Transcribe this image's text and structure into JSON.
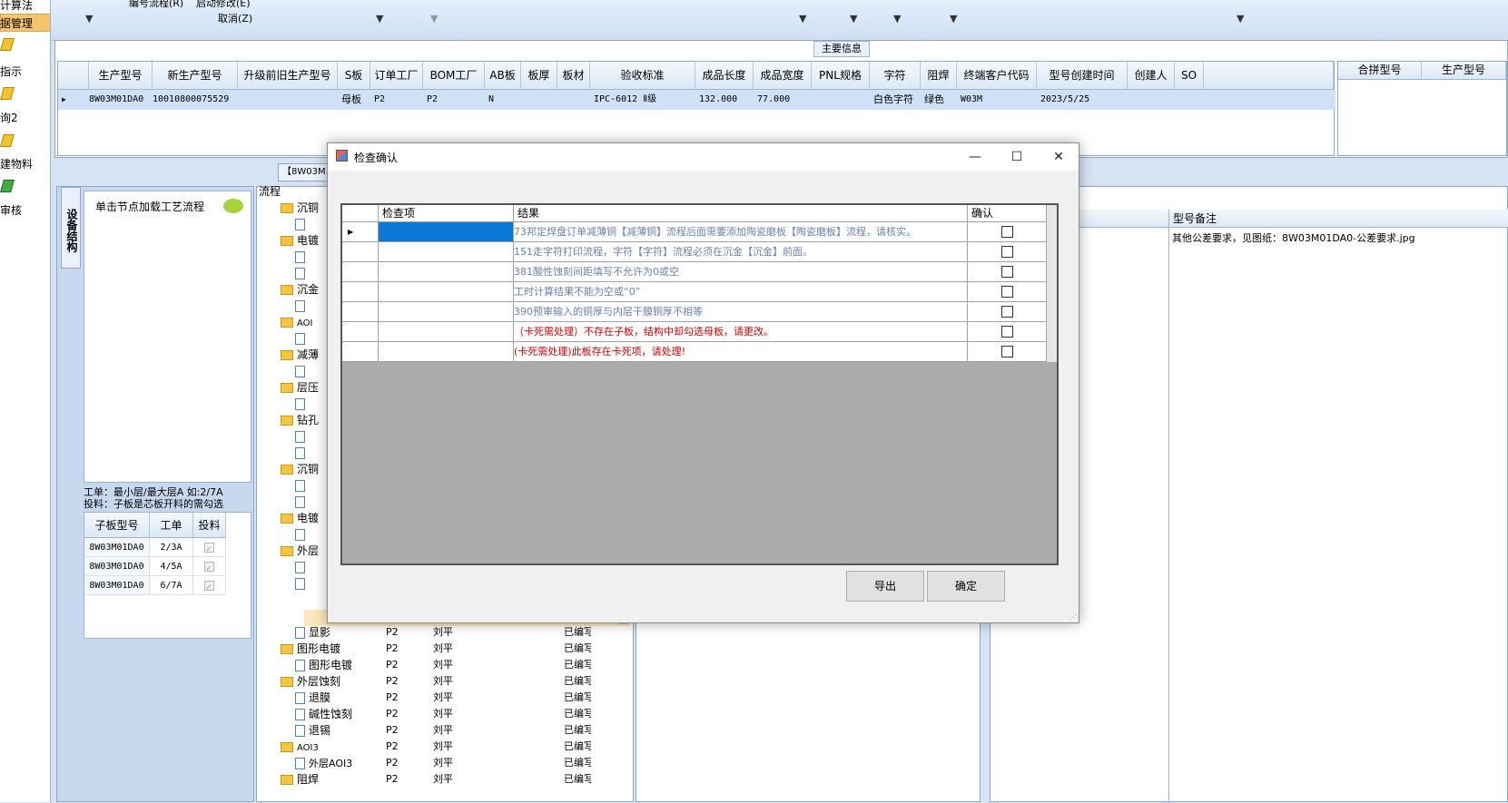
{
  "left_nav": {
    "items": [
      "计算法",
      "据管理",
      "指示",
      "询2",
      "建物料",
      "审核"
    ]
  },
  "toolbar": {
    "items": [
      "编号流程(R)",
      "启动修改(E)",
      "取消(Z)"
    ]
  },
  "main_info": {
    "group_label": "主要信息",
    "columns": [
      "生产型号",
      "新生产型号",
      "升级前旧生产型号",
      "S板",
      "订单工厂",
      "BOM工厂",
      "AB板",
      "板厚",
      "板材",
      "验收标准",
      "成品长度",
      "成品宽度",
      "PNL规格",
      "字符",
      "阻焊",
      "终端客户代码",
      "型号创建时间",
      "创建人",
      "SO"
    ],
    "row": {
      "生产型号": "8W03M01DA0",
      "新生产型号": "10010800075529",
      "S板": "母板",
      "订单工厂": "P2",
      "BOM工厂": "P2",
      "AB板": "N",
      "验收标准": "IPC-6012 Ⅱ级",
      "成品长度": "132.000",
      "成品宽度": "77.000",
      "字符": "白色字符",
      "阻焊": "绿色",
      "终端客户代码": "W03M",
      "型号创建时间": "2023/5/25"
    },
    "right_columns": [
      "合拼型号",
      "生产型号"
    ]
  },
  "tab": {
    "label": "【8W03M..."
  },
  "left_panel": {
    "vertical_tab": "设备结构",
    "load_hint": "单击节点加载工艺流程",
    "info_line1": "工单：最小层/最大层A 如:2/7A",
    "info_line2": "投料：子板是芯板开料的需勾选",
    "sub_columns": [
      "子板型号",
      "工单",
      "投料"
    ],
    "sub_rows": [
      {
        "model": "8W03M01DA0",
        "order": "2/3A"
      },
      {
        "model": "8W03M01DA0",
        "order": "4/5A"
      },
      {
        "model": "8W03M01DA0",
        "order": "6/7A"
      }
    ]
  },
  "tree": {
    "header": "流程",
    "top_nodes": [
      "沉铜",
      "电镀",
      "沉金",
      "AOI",
      "减薄",
      "层压",
      "钻孔",
      "沉铜",
      "电镀",
      "外层"
    ],
    "rows": [
      {
        "name": "显影",
        "factory": "P2",
        "person": "刘平",
        "status": "已编写",
        "level": 2
      },
      {
        "name": "图形电镀",
        "factory": "P2",
        "person": "刘平",
        "status": "已编写",
        "level": 1
      },
      {
        "name": "图形电镀",
        "factory": "P2",
        "person": "刘平",
        "status": "已编写",
        "level": 2
      },
      {
        "name": "外层蚀刻",
        "factory": "P2",
        "person": "刘平",
        "status": "已编写",
        "level": 1
      },
      {
        "name": "退膜",
        "factory": "P2",
        "person": "刘平",
        "status": "已编写",
        "level": 2
      },
      {
        "name": "碱性蚀刻",
        "factory": "P2",
        "person": "刘平",
        "status": "已编写",
        "level": 2
      },
      {
        "name": "退锡",
        "factory": "P2",
        "person": "刘平",
        "status": "已编写",
        "level": 2
      },
      {
        "name": "AOI3",
        "factory": "P2",
        "person": "刘平",
        "status": "已编写",
        "level": 1
      },
      {
        "name": "外层AOI3",
        "factory": "P2",
        "person": "刘平",
        "status": "已编写",
        "level": 2
      },
      {
        "name": "阻焊",
        "factory": "P2",
        "person": "刘平",
        "status": "已编写",
        "level": 1
      }
    ]
  },
  "right_panel": {
    "remark_header": "型号备注",
    "remark_text": "其他公差要求，见图纸：8W03M01DA0-公差要求.jpg"
  },
  "dialog": {
    "title": "检查确认",
    "columns": [
      "检查项",
      "结果",
      "确认"
    ],
    "rows": [
      {
        "result": "73邦定焊盘订单减薄铜【减薄铜】流程后面需要添加陶瓷磨板【陶瓷磨板】流程，请核实。",
        "color": "#6b7fb0"
      },
      {
        "result": "151走字符打印流程，字符【字符】流程必须在沉金【沉金】前面。",
        "color": "#6b7fb0"
      },
      {
        "result": "381酸性蚀刻间距填写不允许为0或空",
        "color": "#6b7fb0"
      },
      {
        "result": "工时计算结果不能为空或“0”",
        "color": "#6b7fb0"
      },
      {
        "result": "390预审输入的铜厚与内层干膜铜厚不相等",
        "color": "#6b7fb0"
      },
      {
        "result": "（卡死需处理）不存在子板，结构中却勾选母板，请更改。",
        "color": "#d40000"
      },
      {
        "result": "(卡死需处理)此板存在卡死项，请处理!",
        "color": "#d40000"
      }
    ],
    "export_label": "导出",
    "ok_label": "确定",
    "minimize": "—",
    "maximize": "☐",
    "close": "✕"
  }
}
